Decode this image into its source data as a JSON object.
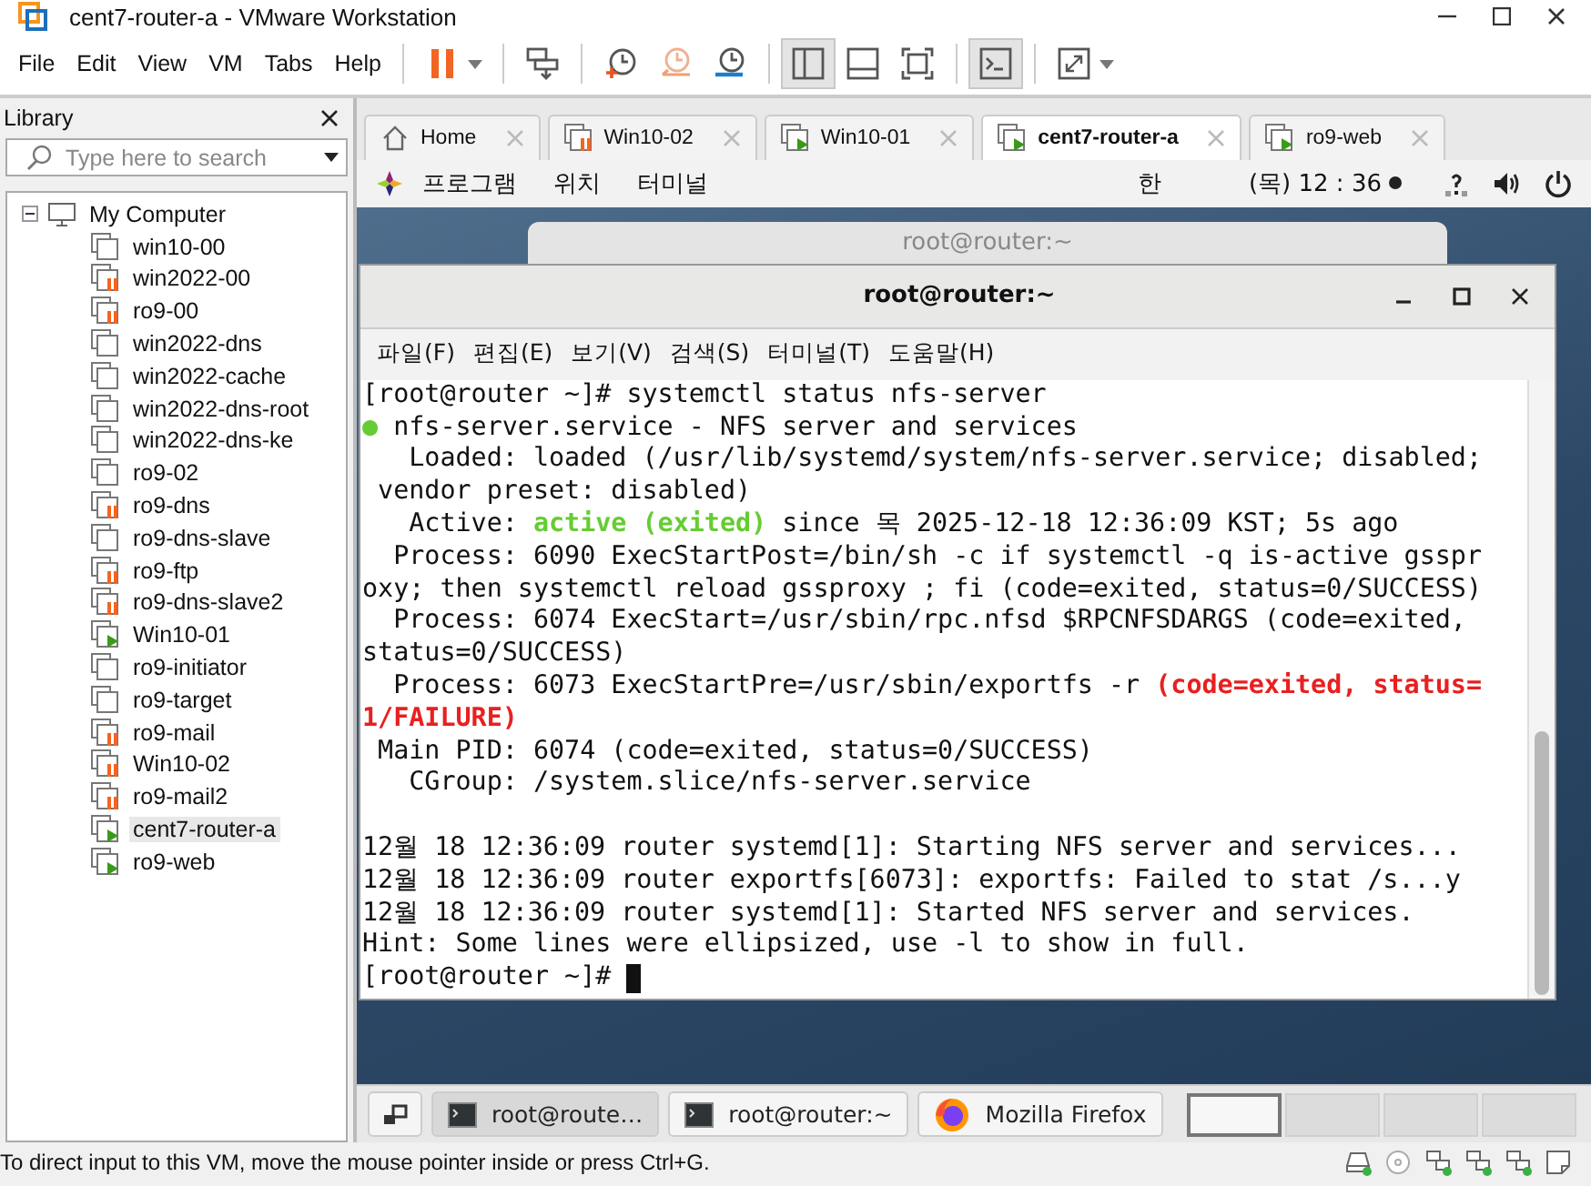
{
  "window": {
    "title": "cent7-router-a - VMware Workstation"
  },
  "menu": [
    "File",
    "Edit",
    "View",
    "VM",
    "Tabs",
    "Help"
  ],
  "toolbar": [
    {
      "kind": "pause",
      "pressed": false,
      "has_menu": true
    },
    {
      "kind": "send-keys",
      "pressed": false,
      "has_menu": false
    },
    {
      "kind": "snapshot-take",
      "pressed": false,
      "has_menu": false
    },
    {
      "kind": "snapshot-revert",
      "pressed": false,
      "has_menu": false
    },
    {
      "kind": "snapshot-manager",
      "pressed": false,
      "has_menu": false
    },
    {
      "kind": "view-library",
      "pressed": true,
      "has_menu": false
    },
    {
      "kind": "view-thumbnails",
      "pressed": false,
      "has_menu": false
    },
    {
      "kind": "view-fit",
      "pressed": false,
      "has_menu": false
    },
    {
      "kind": "view-console",
      "pressed": true,
      "has_menu": false
    },
    {
      "kind": "fullscreen",
      "pressed": false,
      "has_menu": true
    }
  ],
  "library": {
    "title": "Library",
    "search": {
      "placeholder": "Type here to search"
    },
    "tree": {
      "label": "My Computer",
      "expanded": true,
      "children": [
        {
          "label": "win10-00",
          "kind": "off",
          "selected": false
        },
        {
          "label": "win2022-00",
          "kind": "paused",
          "selected": false
        },
        {
          "label": "ro9-00",
          "kind": "paused",
          "selected": false
        },
        {
          "label": "win2022-dns",
          "kind": "off",
          "selected": false
        },
        {
          "label": "win2022-cache",
          "kind": "off",
          "selected": false
        },
        {
          "label": "win2022-dns-root",
          "kind": "off",
          "selected": false
        },
        {
          "label": "win2022-dns-ke",
          "kind": "off",
          "selected": false
        },
        {
          "label": "ro9-02",
          "kind": "off",
          "selected": false
        },
        {
          "label": "ro9-dns",
          "kind": "paused",
          "selected": false
        },
        {
          "label": "ro9-dns-slave",
          "kind": "off",
          "selected": false
        },
        {
          "label": "ro9-ftp",
          "kind": "paused",
          "selected": false
        },
        {
          "label": "ro9-dns-slave2",
          "kind": "paused",
          "selected": false
        },
        {
          "label": "Win10-01",
          "kind": "running",
          "selected": false
        },
        {
          "label": "ro9-initiator",
          "kind": "off",
          "selected": false
        },
        {
          "label": "ro9-target",
          "kind": "off",
          "selected": false
        },
        {
          "label": "ro9-mail",
          "kind": "paused",
          "selected": false
        },
        {
          "label": "Win10-02",
          "kind": "paused",
          "selected": false
        },
        {
          "label": "ro9-mail2",
          "kind": "paused",
          "selected": false
        },
        {
          "label": "cent7-router-a",
          "kind": "running",
          "selected": true
        },
        {
          "label": "ro9-web",
          "kind": "running",
          "selected": false
        }
      ]
    }
  },
  "tabs": [
    {
      "label": "Home",
      "kind": "home",
      "selected": false
    },
    {
      "label": "Win10-02",
      "kind": "paused",
      "selected": false
    },
    {
      "label": "Win10-01",
      "kind": "running",
      "selected": false
    },
    {
      "label": "cent7-router-a",
      "kind": "running",
      "selected": true
    },
    {
      "label": "ro9-web",
      "kind": "running",
      "selected": false
    }
  ],
  "guest": {
    "top_bar": {
      "menus": [
        "프로그램",
        "위치",
        "터미널"
      ],
      "input_method": "한",
      "clock": "(목) 12 : 36",
      "notification_dot": true
    },
    "background_window": {
      "title": "root@router:~"
    },
    "terminal": {
      "title": "root@router:~",
      "menu": [
        "파일(F)",
        "편집(E)",
        "보기(V)",
        "검색(S)",
        "터미널(T)",
        "도움말(H)"
      ],
      "cursor": true,
      "lines": [
        {
          "spans": [
            {
              "text": "[root@router ~]# systemctl status nfs-server",
              "kind": "plain"
            }
          ]
        },
        {
          "spans": [
            {
              "text": "●",
              "kind": "green"
            },
            {
              "text": " nfs-server.service - NFS server and services",
              "kind": "plain"
            }
          ]
        },
        {
          "spans": [
            {
              "text": "   Loaded: loaded (/usr/lib/systemd/system/nfs-server.service; disabled;",
              "kind": "plain"
            }
          ]
        },
        {
          "spans": [
            {
              "text": " vendor preset: disabled)",
              "kind": "plain"
            }
          ]
        },
        {
          "spans": [
            {
              "text": "   Active: ",
              "kind": "plain"
            },
            {
              "text": "active (exited)",
              "kind": "green-bold"
            },
            {
              "text": " since 목 2025-12-18 12:36:09 KST; 5s ago",
              "kind": "plain"
            }
          ]
        },
        {
          "spans": [
            {
              "text": "  Process: 6090 ExecStartPost=/bin/sh -c if systemctl -q is-active gsspr",
              "kind": "plain"
            }
          ]
        },
        {
          "spans": [
            {
              "text": "oxy; then systemctl reload gssproxy ; fi (code=exited, status=0/SUCCESS)",
              "kind": "plain"
            }
          ]
        },
        {
          "spans": [
            {
              "text": "  Process: 6074 ExecStart=/usr/sbin/rpc.nfsd $RPCNFSDARGS (code=exited,",
              "kind": "plain"
            }
          ]
        },
        {
          "spans": [
            {
              "text": "status=0/SUCCESS)",
              "kind": "plain"
            }
          ]
        },
        {
          "spans": [
            {
              "text": "  Process: 6073 ExecStartPre=/usr/sbin/exportfs -r ",
              "kind": "plain"
            },
            {
              "text": "(code=exited, status=",
              "kind": "red-bold"
            }
          ]
        },
        {
          "spans": [
            {
              "text": "1/FAILURE)",
              "kind": "red-bold"
            }
          ]
        },
        {
          "spans": [
            {
              "text": " Main PID: 6074 (code=exited, status=0/SUCCESS)",
              "kind": "plain"
            }
          ]
        },
        {
          "spans": [
            {
              "text": "   CGroup: /system.slice/nfs-server.service",
              "kind": "plain"
            }
          ]
        },
        {
          "blank_before": true,
          "spans": [
            {
              "text": "12월 18 12:36:09 router systemd[1]: Starting NFS server and services...",
              "kind": "plain"
            }
          ]
        },
        {
          "spans": [
            {
              "text": "12월 18 12:36:09 router exportfs[6073]: exportfs: Failed to stat /s...y",
              "kind": "plain"
            }
          ]
        },
        {
          "spans": [
            {
              "text": "12월 18 12:36:09 router systemd[1]: Started NFS server and services.",
              "kind": "plain"
            }
          ]
        },
        {
          "spans": [
            {
              "text": "Hint: Some lines were ellipsized, use -l to show in full.",
              "kind": "plain"
            }
          ]
        },
        {
          "spans": [
            {
              "text": "[root@router ~]# ",
              "kind": "plain"
            }
          ]
        }
      ]
    },
    "taskbar": {
      "items": [
        {
          "label": "root@route…",
          "kind": "terminal",
          "selected": true
        },
        {
          "label": "root@router:~",
          "kind": "terminal",
          "selected": false
        },
        {
          "label": "Mozilla Firefox",
          "kind": "browser",
          "selected": false
        }
      ],
      "workspaces": [
        {
          "selected": true
        },
        {
          "selected": false
        },
        {
          "selected": false
        },
        {
          "selected": false
        }
      ]
    }
  },
  "status_bar": {
    "message": "To direct input to this VM, move the mouse pointer inside or press Ctrl+G.",
    "devices": [
      {
        "kind": "disk"
      },
      {
        "kind": "cd"
      },
      {
        "kind": "network"
      },
      {
        "kind": "network"
      },
      {
        "kind": "network"
      },
      {
        "kind": "messages"
      }
    ]
  }
}
